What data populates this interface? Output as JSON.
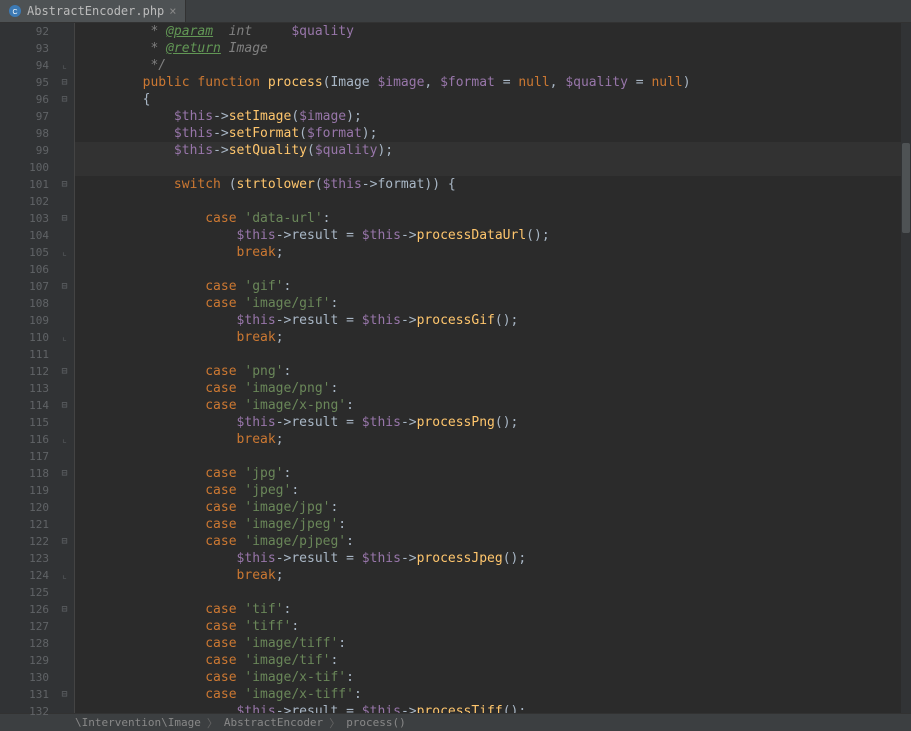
{
  "tab": {
    "filename": "AbstractEncoder.php",
    "close": "×"
  },
  "breadcrumb": {
    "seg1": "\\Intervention\\Image",
    "seg2": "AbstractEncoder",
    "seg3": "process()"
  },
  "gutter": {
    "start": 92,
    "end": 132
  },
  "code": [
    {
      "n": 92,
      "f": "",
      "t": [
        [
          "doc",
          "         * "
        ],
        [
          "doctag",
          "@param"
        ],
        [
          "doc",
          "  "
        ],
        [
          "doctype",
          "int"
        ],
        [
          "doc",
          "     "
        ],
        [
          "var",
          "$quality"
        ]
      ]
    },
    {
      "n": 93,
      "f": "",
      "t": [
        [
          "doc",
          "         * "
        ],
        [
          "doctag",
          "@return"
        ],
        [
          "doc",
          " Image"
        ]
      ]
    },
    {
      "n": 94,
      "f": "e",
      "t": [
        [
          "doc",
          "         */"
        ]
      ]
    },
    {
      "n": 95,
      "f": "m",
      "t": [
        [
          "id",
          "        "
        ],
        [
          "kw",
          "public function "
        ],
        [
          "fn",
          "process"
        ],
        [
          "op",
          "("
        ],
        [
          "id",
          "Image "
        ],
        [
          "var",
          "$image"
        ],
        [
          "op",
          ", "
        ],
        [
          "var",
          "$format"
        ],
        [
          "op",
          " = "
        ],
        [
          "null",
          "null"
        ],
        [
          "op",
          ", "
        ],
        [
          "var",
          "$quality"
        ],
        [
          "op",
          " = "
        ],
        [
          "null",
          "null"
        ],
        [
          "op",
          ")"
        ]
      ]
    },
    {
      "n": 96,
      "f": "m",
      "t": [
        [
          "id",
          "        {"
        ]
      ]
    },
    {
      "n": 97,
      "f": "",
      "t": [
        [
          "id",
          "            "
        ],
        [
          "var",
          "$this"
        ],
        [
          "op",
          "->"
        ],
        [
          "fn",
          "setImage"
        ],
        [
          "op",
          "("
        ],
        [
          "var",
          "$image"
        ],
        [
          "op",
          ");"
        ]
      ]
    },
    {
      "n": 98,
      "f": "",
      "t": [
        [
          "id",
          "            "
        ],
        [
          "var",
          "$this"
        ],
        [
          "op",
          "->"
        ],
        [
          "fn",
          "setFormat"
        ],
        [
          "op",
          "("
        ],
        [
          "var",
          "$format"
        ],
        [
          "op",
          ");"
        ]
      ]
    },
    {
      "n": 99,
      "f": "",
      "hl": true,
      "t": [
        [
          "id",
          "            "
        ],
        [
          "var",
          "$this"
        ],
        [
          "op",
          "->"
        ],
        [
          "fn",
          "setQuality"
        ],
        [
          "op",
          "("
        ],
        [
          "var",
          "$quality"
        ],
        [
          "op",
          ");"
        ]
      ]
    },
    {
      "n": 100,
      "f": "",
      "cursor": true,
      "t": [
        [
          "id",
          ""
        ]
      ]
    },
    {
      "n": 101,
      "f": "m",
      "t": [
        [
          "id",
          "            "
        ],
        [
          "kw",
          "switch "
        ],
        [
          "op",
          "("
        ],
        [
          "fn",
          "strtolower"
        ],
        [
          "op",
          "("
        ],
        [
          "var",
          "$this"
        ],
        [
          "op",
          "->"
        ],
        [
          "id",
          "format"
        ],
        [
          "op",
          ")) {"
        ]
      ]
    },
    {
      "n": 102,
      "f": "",
      "t": [
        [
          "id",
          ""
        ]
      ]
    },
    {
      "n": 103,
      "f": "m",
      "t": [
        [
          "id",
          "                "
        ],
        [
          "kw",
          "case "
        ],
        [
          "str",
          "'data-url'"
        ],
        [
          "op",
          ":"
        ]
      ]
    },
    {
      "n": 104,
      "f": "",
      "t": [
        [
          "id",
          "                    "
        ],
        [
          "var",
          "$this"
        ],
        [
          "op",
          "->"
        ],
        [
          "id",
          "result"
        ],
        [
          "op",
          " = "
        ],
        [
          "var",
          "$this"
        ],
        [
          "op",
          "->"
        ],
        [
          "fn",
          "processDataUrl"
        ],
        [
          "op",
          "();"
        ]
      ]
    },
    {
      "n": 105,
      "f": "e",
      "t": [
        [
          "id",
          "                    "
        ],
        [
          "kw",
          "break"
        ],
        [
          "op",
          ";"
        ]
      ]
    },
    {
      "n": 106,
      "f": "",
      "t": [
        [
          "id",
          ""
        ]
      ]
    },
    {
      "n": 107,
      "f": "m",
      "t": [
        [
          "id",
          "                "
        ],
        [
          "kw",
          "case "
        ],
        [
          "str",
          "'gif'"
        ],
        [
          "op",
          ":"
        ]
      ]
    },
    {
      "n": 108,
      "f": "",
      "t": [
        [
          "id",
          "                "
        ],
        [
          "kw",
          "case "
        ],
        [
          "str",
          "'image/gif'"
        ],
        [
          "op",
          ":"
        ]
      ]
    },
    {
      "n": 109,
      "f": "",
      "t": [
        [
          "id",
          "                    "
        ],
        [
          "var",
          "$this"
        ],
        [
          "op",
          "->"
        ],
        [
          "id",
          "result"
        ],
        [
          "op",
          " = "
        ],
        [
          "var",
          "$this"
        ],
        [
          "op",
          "->"
        ],
        [
          "fn",
          "processGif"
        ],
        [
          "op",
          "();"
        ]
      ]
    },
    {
      "n": 110,
      "f": "e",
      "t": [
        [
          "id",
          "                    "
        ],
        [
          "kw",
          "break"
        ],
        [
          "op",
          ";"
        ]
      ]
    },
    {
      "n": 111,
      "f": "",
      "t": [
        [
          "id",
          ""
        ]
      ]
    },
    {
      "n": 112,
      "f": "m",
      "t": [
        [
          "id",
          "                "
        ],
        [
          "kw",
          "case "
        ],
        [
          "str",
          "'png'"
        ],
        [
          "op",
          ":"
        ]
      ]
    },
    {
      "n": 113,
      "f": "",
      "t": [
        [
          "id",
          "                "
        ],
        [
          "kw",
          "case "
        ],
        [
          "str",
          "'image/png'"
        ],
        [
          "op",
          ":"
        ]
      ]
    },
    {
      "n": 114,
      "f": "m",
      "t": [
        [
          "id",
          "                "
        ],
        [
          "kw",
          "case "
        ],
        [
          "str",
          "'image/x-png'"
        ],
        [
          "op",
          ":"
        ]
      ]
    },
    {
      "n": 115,
      "f": "",
      "t": [
        [
          "id",
          "                    "
        ],
        [
          "var",
          "$this"
        ],
        [
          "op",
          "->"
        ],
        [
          "id",
          "result"
        ],
        [
          "op",
          " = "
        ],
        [
          "var",
          "$this"
        ],
        [
          "op",
          "->"
        ],
        [
          "fn",
          "processPng"
        ],
        [
          "op",
          "();"
        ]
      ]
    },
    {
      "n": 116,
      "f": "e",
      "t": [
        [
          "id",
          "                    "
        ],
        [
          "kw",
          "break"
        ],
        [
          "op",
          ";"
        ]
      ]
    },
    {
      "n": 117,
      "f": "",
      "t": [
        [
          "id",
          ""
        ]
      ]
    },
    {
      "n": 118,
      "f": "m",
      "t": [
        [
          "id",
          "                "
        ],
        [
          "kw",
          "case "
        ],
        [
          "str",
          "'jpg'"
        ],
        [
          "op",
          ":"
        ]
      ]
    },
    {
      "n": 119,
      "f": "",
      "t": [
        [
          "id",
          "                "
        ],
        [
          "kw",
          "case "
        ],
        [
          "str",
          "'jpeg'"
        ],
        [
          "op",
          ":"
        ]
      ]
    },
    {
      "n": 120,
      "f": "",
      "t": [
        [
          "id",
          "                "
        ],
        [
          "kw",
          "case "
        ],
        [
          "str",
          "'image/jpg'"
        ],
        [
          "op",
          ":"
        ]
      ]
    },
    {
      "n": 121,
      "f": "",
      "t": [
        [
          "id",
          "                "
        ],
        [
          "kw",
          "case "
        ],
        [
          "str",
          "'image/jpeg'"
        ],
        [
          "op",
          ":"
        ]
      ]
    },
    {
      "n": 122,
      "f": "m",
      "t": [
        [
          "id",
          "                "
        ],
        [
          "kw",
          "case "
        ],
        [
          "str",
          "'image/pjpeg'"
        ],
        [
          "op",
          ":"
        ]
      ]
    },
    {
      "n": 123,
      "f": "",
      "t": [
        [
          "id",
          "                    "
        ],
        [
          "var",
          "$this"
        ],
        [
          "op",
          "->"
        ],
        [
          "id",
          "result"
        ],
        [
          "op",
          " = "
        ],
        [
          "var",
          "$this"
        ],
        [
          "op",
          "->"
        ],
        [
          "fn",
          "processJpeg"
        ],
        [
          "op",
          "();"
        ]
      ]
    },
    {
      "n": 124,
      "f": "e",
      "t": [
        [
          "id",
          "                    "
        ],
        [
          "kw",
          "break"
        ],
        [
          "op",
          ";"
        ]
      ]
    },
    {
      "n": 125,
      "f": "",
      "t": [
        [
          "id",
          ""
        ]
      ]
    },
    {
      "n": 126,
      "f": "m",
      "t": [
        [
          "id",
          "                "
        ],
        [
          "kw",
          "case "
        ],
        [
          "str",
          "'tif'"
        ],
        [
          "op",
          ":"
        ]
      ]
    },
    {
      "n": 127,
      "f": "",
      "t": [
        [
          "id",
          "                "
        ],
        [
          "kw",
          "case "
        ],
        [
          "str",
          "'tiff'"
        ],
        [
          "op",
          ":"
        ]
      ]
    },
    {
      "n": 128,
      "f": "",
      "t": [
        [
          "id",
          "                "
        ],
        [
          "kw",
          "case "
        ],
        [
          "str",
          "'image/tiff'"
        ],
        [
          "op",
          ":"
        ]
      ]
    },
    {
      "n": 129,
      "f": "",
      "t": [
        [
          "id",
          "                "
        ],
        [
          "kw",
          "case "
        ],
        [
          "str",
          "'image/tif'"
        ],
        [
          "op",
          ":"
        ]
      ]
    },
    {
      "n": 130,
      "f": "",
      "t": [
        [
          "id",
          "                "
        ],
        [
          "kw",
          "case "
        ],
        [
          "str",
          "'image/x-tif'"
        ],
        [
          "op",
          ":"
        ]
      ]
    },
    {
      "n": 131,
      "f": "m",
      "t": [
        [
          "id",
          "                "
        ],
        [
          "kw",
          "case "
        ],
        [
          "str",
          "'image/x-tiff'"
        ],
        [
          "op",
          ":"
        ]
      ]
    },
    {
      "n": 132,
      "f": "",
      "t": [
        [
          "id",
          "                    "
        ],
        [
          "var",
          "$this"
        ],
        [
          "op",
          "->"
        ],
        [
          "id",
          "result"
        ],
        [
          "op",
          " = "
        ],
        [
          "var",
          "$this"
        ],
        [
          "op",
          "->"
        ],
        [
          "fn",
          "processTiff"
        ],
        [
          "op",
          "();"
        ]
      ]
    }
  ]
}
